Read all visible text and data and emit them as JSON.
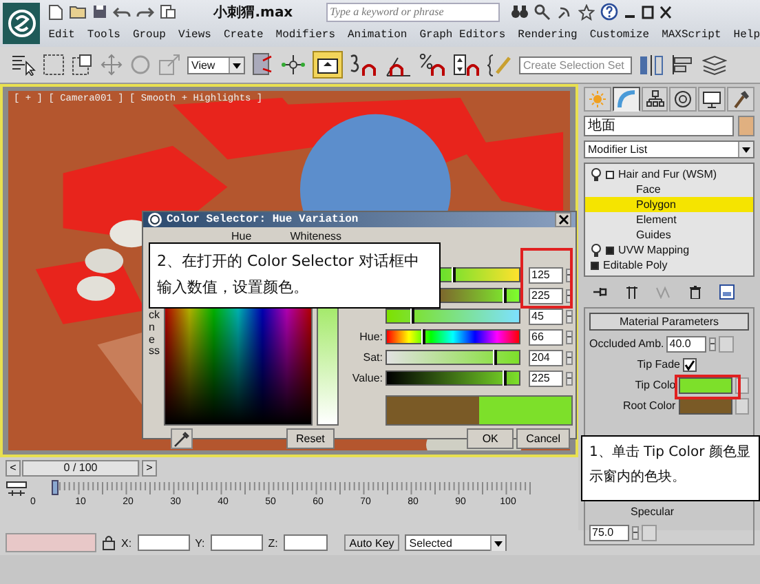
{
  "app": {
    "title": "小刺猬.max",
    "search": {
      "placeholder": "Type a keyword or phrase"
    }
  },
  "menu": [
    "Edit",
    "Tools",
    "Group",
    "Views",
    "Create",
    "Modifiers",
    "Animation",
    "Graph Editors",
    "Rendering",
    "Customize",
    "MAXScript",
    "Help"
  ],
  "toolbar": {
    "view_dropdown": "View",
    "selection_set": {
      "placeholder": "Create Selection Set"
    }
  },
  "viewport": {
    "label": "[ + ] [ Camera001 ] [ Smooth + Highlights ]"
  },
  "color_selector": {
    "title": "Color Selector: Hue Variation",
    "hue_label": "Hue",
    "whiteness_label": "Whiteness",
    "blackness_label": "ckness",
    "rgb": [
      {
        "value": "125",
        "level": 0.49
      },
      {
        "value": "225",
        "level": 0.88
      },
      {
        "value": "45",
        "level": 0.18
      }
    ],
    "hsv": [
      {
        "label": "Hue:",
        "value": "66",
        "level": 0.26
      },
      {
        "label": "Sat:",
        "value": "204",
        "level": 0.8
      },
      {
        "label": "Value:",
        "value": "225",
        "level": 0.88
      }
    ],
    "buttons": [
      "Reset",
      "OK",
      "Cancel"
    ]
  },
  "command_panel": {
    "tabs": [
      {
        "kind": "light",
        "selected": false
      },
      {
        "kind": "arc",
        "selected": true
      },
      {
        "kind": "hierarchy",
        "selected": false
      },
      {
        "kind": "motion",
        "selected": false
      },
      {
        "kind": "display",
        "selected": false
      },
      {
        "kind": "hammer",
        "selected": false
      }
    ],
    "object_name": "地面",
    "modifier_list": "Modifier List",
    "stack": [
      {
        "label": "Hair and Fur (WSM)",
        "expanded": true,
        "children": [
          {
            "label": "Face",
            "selected": false
          },
          {
            "label": "Polygon",
            "selected": true
          },
          {
            "label": "Element",
            "selected": false
          },
          {
            "label": "Guides",
            "selected": false
          }
        ]
      },
      {
        "label": "UVW Mapping",
        "expanded": false
      },
      {
        "label": "Editable Poly",
        "expanded": false
      }
    ],
    "rollout": {
      "title": "Material Parameters",
      "params": [
        {
          "kind": "spinner",
          "label": "Occluded Amb.",
          "value": "40.0"
        },
        {
          "kind": "checkbox",
          "label": "Tip Fade",
          "checked": true
        },
        {
          "kind": "color",
          "label": "Tip Colo",
          "color": "#7de02a"
        },
        {
          "kind": "color",
          "label": "Root Color",
          "color": "#7a5a26"
        },
        {
          "kind": "label",
          "label": "Specular"
        },
        {
          "kind": "spinner",
          "value": "75.0"
        }
      ]
    }
  },
  "timeline": {
    "prev": "<",
    "frame": "0 / 100",
    "level": 0,
    "next": ">",
    "ticks": [
      "0",
      "10",
      "20",
      "30",
      "40",
      "50",
      "60",
      "70",
      "80",
      "90",
      "100"
    ]
  },
  "status": {
    "x_label": "X:",
    "y_label": "Y:",
    "z_label": "Z:",
    "auto_key": "Auto Key",
    "key_mode": "Selected"
  },
  "callouts": [
    {
      "text": "2、在打开的 Color Selector 对话框中输入数值，设置颜色。"
    },
    {
      "text": "1、单击 Tip Color 颜色显示窗内的色块。"
    }
  ]
}
